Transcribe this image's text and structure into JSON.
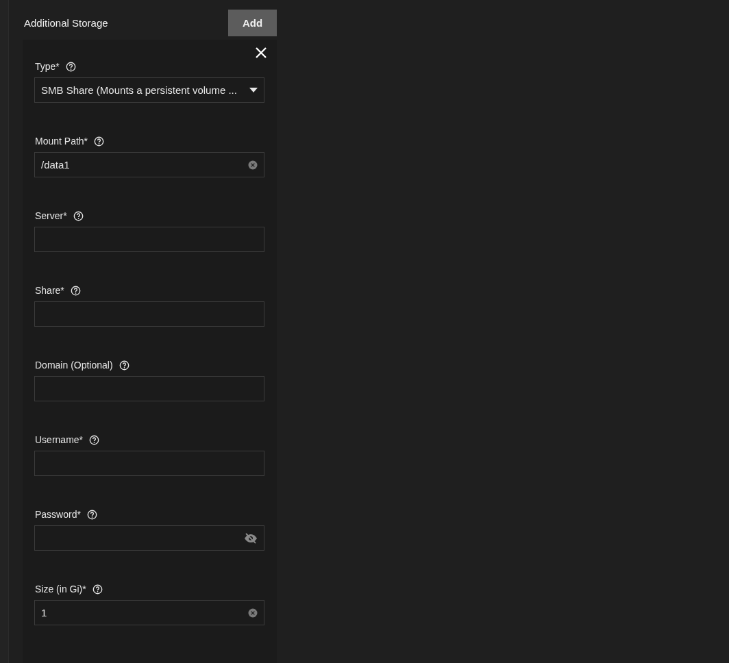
{
  "section": {
    "title": "Additional Storage",
    "add_button": "Add"
  },
  "form": {
    "fields": [
      {
        "label": "Type*",
        "kind": "select",
        "value": "SMB Share (Mounts a persistent volume ..."
      },
      {
        "label": "Mount Path*",
        "kind": "text",
        "value": "/data1"
      },
      {
        "label": "Server*",
        "kind": "text"
      },
      {
        "label": "Share*",
        "kind": "text"
      },
      {
        "label": "Domain (Optional)",
        "kind": "text"
      },
      {
        "label": "Username*",
        "kind": "text"
      },
      {
        "label": "Password*",
        "kind": "password"
      },
      {
        "label": "Size (in Gi)*",
        "kind": "text",
        "value": "1"
      }
    ]
  }
}
